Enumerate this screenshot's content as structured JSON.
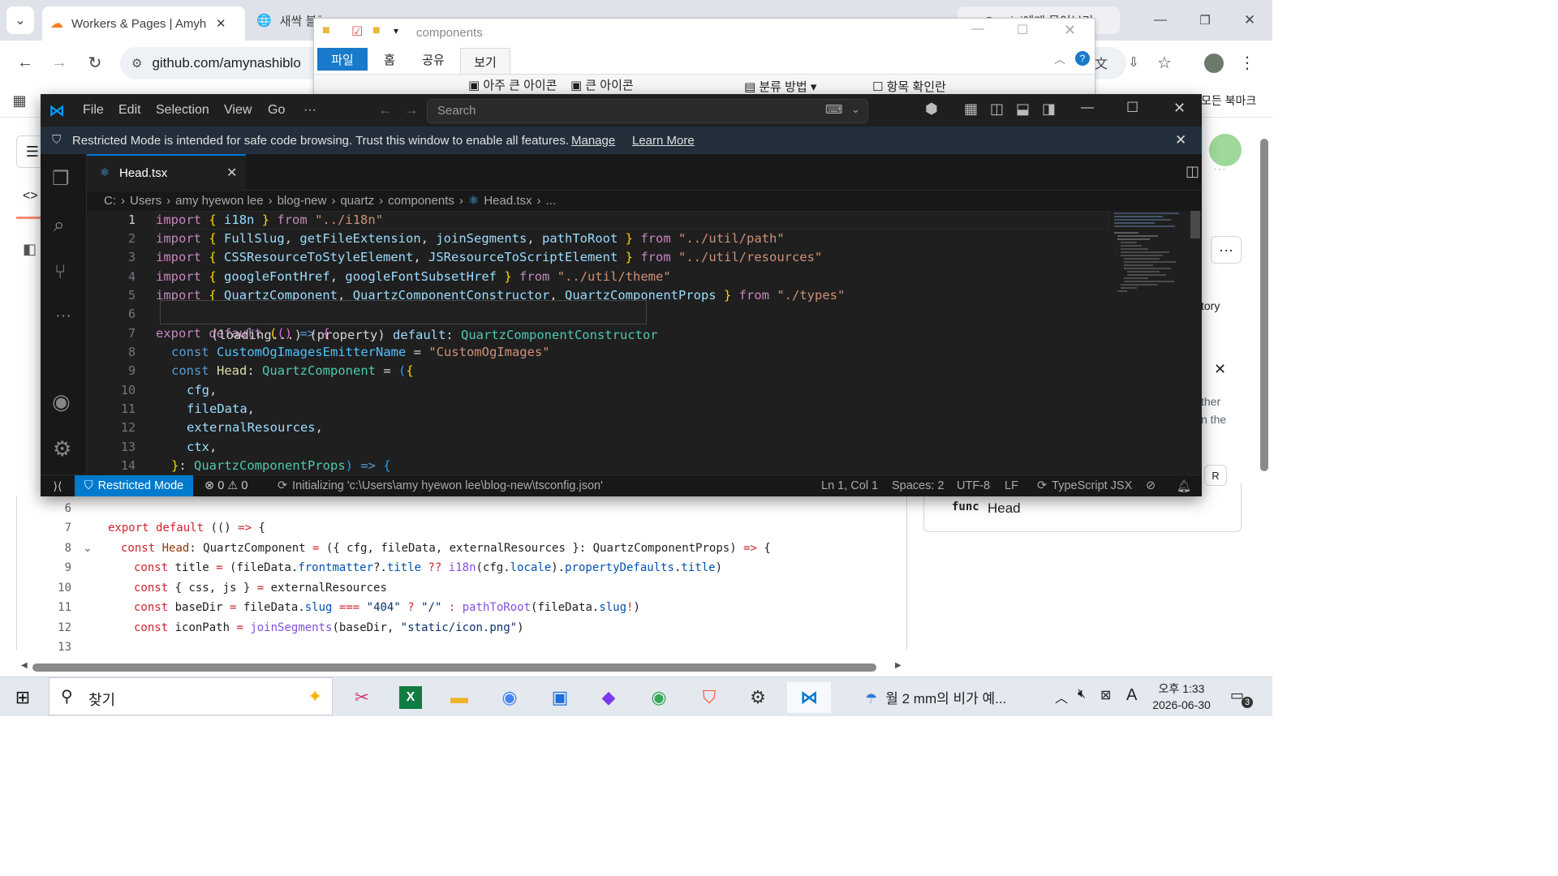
{
  "chrome": {
    "tabs": [
      {
        "label": "Workers & Pages | Amyh",
        "icon": "cloudflare-icon"
      },
      {
        "label": "새싹 블로그 페이지",
        "icon": "globe-icon"
      },
      {
        "label": "...",
        "icon": "youtube-icon"
      },
      {
        "label": "",
        "icon": "github-icon"
      },
      {
        "label": "Gemini에게 물어보기",
        "icon": "gemini-icon"
      }
    ],
    "url": "github.com/amynashiblo",
    "bookmarks_label": "모든 북마크"
  },
  "explorer": {
    "path": "components",
    "ribbon_tabs": [
      "파일",
      "홈",
      "공유",
      "보기"
    ],
    "view_options": [
      "아주 큰 아이콘",
      "큰 아이콘"
    ],
    "group_by": "분류 방법",
    "item_check": "항목 확인란"
  },
  "vscode": {
    "menu": [
      "File",
      "Edit",
      "Selection",
      "View",
      "Go",
      "···"
    ],
    "search_placeholder": "Search",
    "banner": {
      "text": "Restricted Mode is intended for safe code browsing. Trust this window to enable all features.",
      "manage": "Manage",
      "learn_more": "Learn More"
    },
    "tab": "Head.tsx",
    "breadcrumb": [
      "C:",
      "Users",
      "amy hyewon lee",
      "blog-new",
      "quartz",
      "components",
      "Head.tsx",
      "..."
    ],
    "line_numbers": [
      "1",
      "2",
      "3",
      "4",
      "5",
      "6",
      "7",
      "8",
      "9",
      "10",
      "11",
      "12",
      "13",
      "14"
    ],
    "hover": {
      "loading": "(loading...)",
      "kind": "(property)",
      "name": "default",
      "type": "QuartzComponentConstructor"
    },
    "status": {
      "mode": "Restricted Mode",
      "errors": "0",
      "warnings": "0",
      "init": "Initializing 'c:\\Users\\amy hyewon lee\\blog-new\\tsconfig.json'",
      "position": "Ln 1, Col 1",
      "spaces": "Spaces: 2",
      "encoding": "UTF-8",
      "eol": "LF",
      "language": "TypeScript JSX"
    }
  },
  "github": {
    "line_numbers": [
      "6",
      "7",
      "8",
      "9",
      "10",
      "11",
      "12",
      "13"
    ],
    "right_panel": {
      "func_label": "func",
      "func_name": "Head",
      "history": "tory",
      "text1": "ther",
      "text2": "n the",
      "key": "R"
    }
  },
  "taskbar": {
    "search_placeholder": "찾기",
    "weather": "월 2 mm의 비가 예...",
    "time": "오후 1:33",
    "date": "2026-06-30",
    "notifications": "3",
    "ime": "A"
  },
  "colors": {
    "vscode_bg": "#181818",
    "status_accent": "#007acc",
    "chrome_tabstrip": "#dfe3e9",
    "link_blue": "#0b57d0"
  }
}
